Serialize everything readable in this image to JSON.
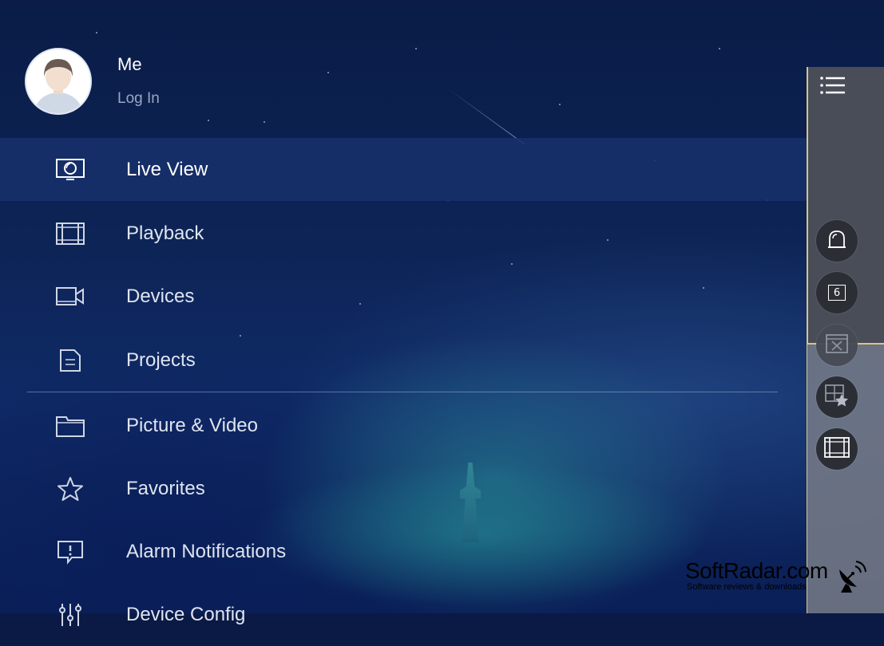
{
  "profile": {
    "name": "Me",
    "login_label": "Log In"
  },
  "menu": {
    "items": [
      {
        "label": "Live View",
        "icon": "monitor-icon",
        "active": true
      },
      {
        "label": "Playback",
        "icon": "film-icon"
      },
      {
        "label": "Devices",
        "icon": "camera-icon"
      },
      {
        "label": "Projects",
        "icon": "document-icon"
      },
      {
        "label": "Picture & Video",
        "icon": "folder-icon"
      },
      {
        "label": "Favorites",
        "icon": "star-icon"
      },
      {
        "label": "Alarm Notifications",
        "icon": "alarm-message-icon"
      },
      {
        "label": "Device Config",
        "icon": "sliders-icon"
      }
    ]
  },
  "side_panel": {
    "buttons": [
      {
        "icon": "alarm-light-icon"
      },
      {
        "icon": "window-count-icon",
        "label": "6"
      },
      {
        "icon": "close-window-icon"
      },
      {
        "icon": "favorite-view-icon"
      },
      {
        "icon": "playback-film-icon"
      }
    ]
  },
  "watermark": {
    "title": "SoftRadar.com",
    "subtitle": "Software reviews & downloads"
  },
  "colors": {
    "active_row": "#18306c",
    "side_panel_border": "#d8c489"
  }
}
